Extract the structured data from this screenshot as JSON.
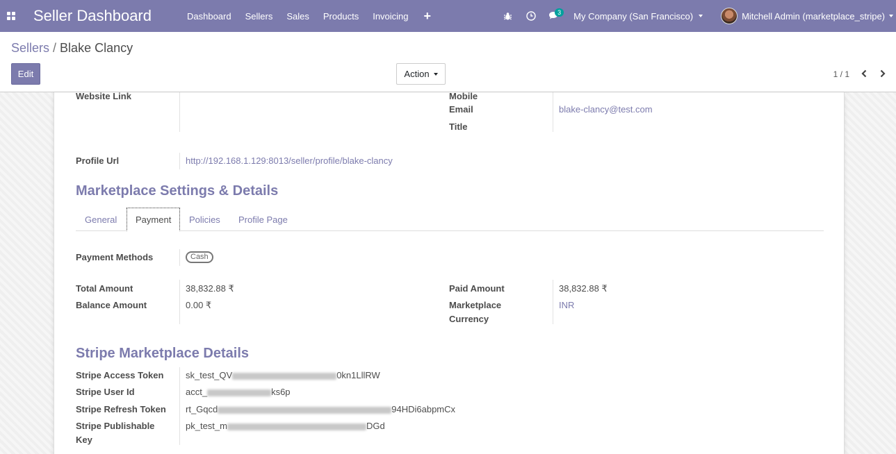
{
  "navbar": {
    "brand": "Seller Dashboard",
    "menu": [
      "Dashboard",
      "Sellers",
      "Sales",
      "Products",
      "Invoicing"
    ],
    "plus": "+",
    "chat_count": "3",
    "company": "My Company (San Francisco)",
    "user": "Mitchell Admin (marketplace_stripe)"
  },
  "breadcrumb": {
    "parent": "Sellers",
    "separator": "/",
    "current": "Blake Clancy"
  },
  "controls": {
    "edit": "Edit",
    "action": "Action",
    "pager": "1 / 1"
  },
  "contact": {
    "website_label": "Website Link",
    "mobile_label": "Mobile",
    "email_label": "Email",
    "email_value": "blake-clancy@test.com",
    "title_label": "Title",
    "profile_label": "Profile Url",
    "profile_value": "http://192.168.1.129:8013/seller/profile/blake-clancy"
  },
  "marketplace": {
    "section_title": "Marketplace Settings & Details",
    "tabs": [
      "General",
      "Payment",
      "Policies",
      "Profile Page"
    ],
    "active_tab": "Payment",
    "payment_methods_label": "Payment Methods",
    "payment_methods": [
      "Cash"
    ],
    "total_amount_label": "Total Amount",
    "total_amount": "38,832.88 ₹",
    "balance_amount_label": "Balance Amount",
    "balance_amount": "0.00 ₹",
    "paid_amount_label": "Paid Amount",
    "paid_amount": "38,832.88 ₹",
    "currency_label_1": "Marketplace",
    "currency_label_2": "Currency",
    "currency": "INR"
  },
  "stripe": {
    "section_title": "Stripe Marketplace Details",
    "access_token_label": "Stripe Access Token",
    "access_token_start": "sk_test_QV",
    "access_token_end": "0kn1LllRW",
    "user_id_label": "Stripe User Id",
    "user_id_start": "acct_",
    "user_id_end": "ks6p",
    "refresh_token_label": "Stripe Refresh Token",
    "refresh_token_start": "rt_Gqcd",
    "refresh_token_end": "94HDi6abpmCx",
    "publishable_key_label_1": "Stripe Publishable",
    "publishable_key_label_2": "Key",
    "publishable_key_start": "pk_test_m",
    "publishable_key_end": "DGd"
  },
  "colors": {
    "primary": "#7c7bad",
    "teal": "#00a09d"
  }
}
